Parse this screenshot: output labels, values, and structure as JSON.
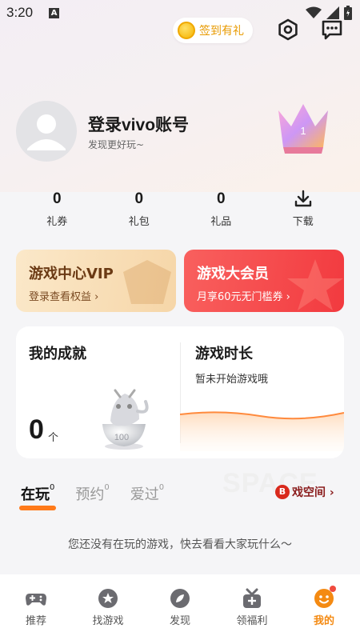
{
  "status_bar": {
    "time": "3:20",
    "indicator": "A",
    "icons": [
      "wifi-icon",
      "signal-icon",
      "battery-icon"
    ]
  },
  "header": {
    "signin_label": "签到有礼",
    "icons": [
      "settings-hexagon-icon",
      "message-icon"
    ]
  },
  "profile": {
    "title": "登录vivo账号",
    "subtitle": "发现更好玩~",
    "crown_level": "1"
  },
  "stats": [
    {
      "value": "0",
      "label": "礼券"
    },
    {
      "value": "0",
      "label": "礼包"
    },
    {
      "value": "0",
      "label": "礼品"
    },
    {
      "label": "下载",
      "icon": "download-icon"
    }
  ],
  "vip_cards": [
    {
      "title": "游戏中心VIP",
      "subtitle": "登录查看权益 ›"
    },
    {
      "title": "游戏大会员",
      "subtitle": "月享60元无门槛券 ›"
    }
  ],
  "achievements": {
    "title": "我的成就",
    "count": "0",
    "unit": "个",
    "badge_text": "100"
  },
  "play_time": {
    "title": "游戏时长",
    "subtitle": "暂未开始游戏哦"
  },
  "tabs": [
    {
      "label": "在玩",
      "count": "0",
      "active": true
    },
    {
      "label": "预约",
      "count": "0",
      "active": false
    },
    {
      "label": "爱过",
      "count": "0",
      "active": false
    }
  ],
  "game_space": {
    "logo": "B",
    "label": "戏空间 ›"
  },
  "watermark": "SPACE",
  "empty_message": "您还没有在玩的游戏，快去看看大家玩什么～",
  "bottom_nav": [
    {
      "label": "推荐",
      "icon": "gamepad-icon",
      "active": false
    },
    {
      "label": "找游戏",
      "icon": "star-badge-icon",
      "active": false
    },
    {
      "label": "发现",
      "icon": "compass-leaf-icon",
      "active": false
    },
    {
      "label": "领福利",
      "icon": "gift-icon",
      "active": false
    },
    {
      "label": "我的",
      "icon": "smiley-icon",
      "active": true
    }
  ],
  "colors": {
    "accent_orange": "#f48a12",
    "tab_underline": "#ff7a1a",
    "vip_gold_bg": "#f6d6a8",
    "vip_red_bg": "#f23a3f",
    "signin_text": "#e89a00"
  }
}
